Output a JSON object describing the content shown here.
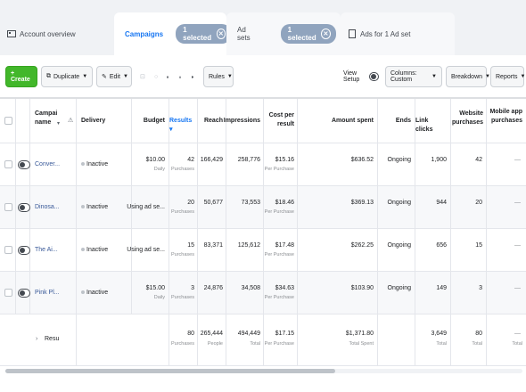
{
  "tabs": {
    "account_overview": "Account overview",
    "campaigns": "Campaigns",
    "campaigns_selected": "1 selected",
    "ad_sets": "Ad sets",
    "ad_sets_selected": "1 selected",
    "ads": "Ads for 1 Ad set"
  },
  "toolbar": {
    "create": "+ Create",
    "duplicate": "Duplicate",
    "edit": "Edit",
    "rules": "Rules",
    "view_setup": "View Setup",
    "columns": "Columns: Custom",
    "breakdown": "Breakdown",
    "reports": "Reports"
  },
  "table": {
    "headers": {
      "name": "Campai name",
      "delivery": "Delivery",
      "budget": "Budget",
      "results": "Results",
      "reach": "Reach",
      "impressions": "Impressions",
      "cost_per_result": "Cost per result",
      "amount_spent": "Amount spent",
      "ends": "Ends",
      "link_clicks": "Link clicks",
      "website_purchases": "Website purchases",
      "mobile_app_purchases": "Mobile app purchases"
    },
    "rows": [
      {
        "name": "Conver...",
        "delivery": "Inactive",
        "budget": "$10.00",
        "budget_sub": "Daily",
        "results": "42",
        "results_sub": "Purchases",
        "reach": "166,429",
        "impressions": "258,776",
        "cost": "$15.16",
        "cost_sub": "Per Purchase",
        "amount": "$636.52",
        "ends": "Ongoing",
        "clicks": "1,900",
        "website": "42",
        "mobile": "—"
      },
      {
        "name": "Dinosa...",
        "delivery": "Inactive",
        "budget": "Using ad se...",
        "budget_sub": "",
        "results": "20",
        "results_sub": "Purchases",
        "reach": "50,677",
        "impressions": "73,553",
        "cost": "$18.46",
        "cost_sub": "Per Purchase",
        "amount": "$369.13",
        "ends": "Ongoing",
        "clicks": "944",
        "website": "20",
        "mobile": "—"
      },
      {
        "name": "The Ai...",
        "delivery": "Inactive",
        "budget": "Using ad se...",
        "budget_sub": "",
        "results": "15",
        "results_sub": "Purchases",
        "reach": "83,371",
        "impressions": "125,612",
        "cost": "$17.48",
        "cost_sub": "Per Purchase",
        "amount": "$262.25",
        "ends": "Ongoing",
        "clicks": "656",
        "website": "15",
        "mobile": "—"
      },
      {
        "name": "Pink Pl...",
        "delivery": "Inactive",
        "budget": "$15.00",
        "budget_sub": "Daily",
        "results": "3",
        "results_sub": "Purchases",
        "reach": "24,876",
        "impressions": "34,508",
        "cost": "$34.63",
        "cost_sub": "Per Purchase",
        "amount": "$103.90",
        "ends": "Ongoing",
        "clicks": "149",
        "website": "3",
        "mobile": "—"
      }
    ],
    "totals": {
      "label": "Resu",
      "results": "80",
      "results_sub": "Purchases",
      "reach": "265,444",
      "reach_sub": "People",
      "impressions": "494,449",
      "impressions_sub": "Total",
      "cost": "$17.15",
      "cost_sub": "Per Purchase",
      "amount": "$1,371.80",
      "amount_sub": "Total Spent",
      "clicks": "3,649",
      "clicks_sub": "Total",
      "website": "80",
      "website_sub": "Total",
      "mobile": "—",
      "mobile_sub": "Total"
    }
  },
  "icons": [
    "campaign-icon",
    "adset-icon",
    "ad-icon",
    "trash-icon",
    "lock-icon",
    "tag-icon"
  ],
  "colors": {
    "accent": "#1877f2",
    "create": "#42b72a",
    "pill": "#90a4be"
  }
}
